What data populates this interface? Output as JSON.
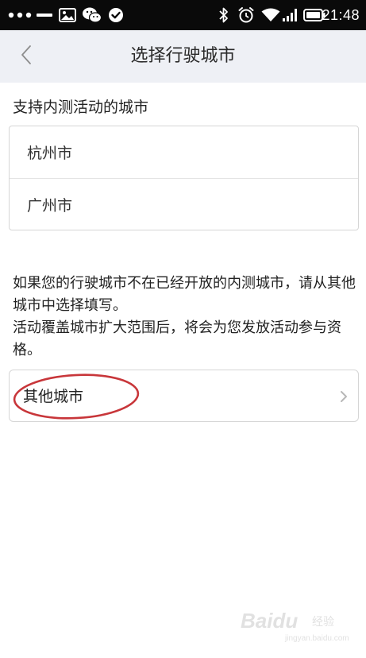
{
  "status_bar": {
    "time": "21:48",
    "left_icons": [
      "more-dots-icon",
      "minus-icon",
      "image-icon",
      "wechat-icon",
      "check-circle-icon"
    ],
    "right_icons": [
      "bluetooth-icon",
      "alarm-icon",
      "wifi-icon",
      "signal-icon",
      "battery-icon"
    ]
  },
  "nav": {
    "title": "选择行驶城市",
    "back_icon": "chevron-left-icon"
  },
  "supported_section": {
    "title": "支持内测活动的城市",
    "cities": [
      "杭州市",
      "广州市"
    ]
  },
  "notice": {
    "line1": "如果您的行驶城市不在已经开放的内测城市，请从其他城市中选择填写。",
    "line2": "活动覆盖城市扩大范围后，将会为您发放活动参与资格。"
  },
  "other_city": {
    "label": "其他城市",
    "chevron_icon": "chevron-right-icon",
    "annotation_color": "#c8363a"
  },
  "watermark": {
    "brand": "Baidu",
    "sub": "经验",
    "url": "jingyan.baidu.com"
  },
  "colors": {
    "status_bar_bg": "#0a0a0a",
    "nav_bg": "#eef0f5",
    "border": "#d6d6d6"
  }
}
